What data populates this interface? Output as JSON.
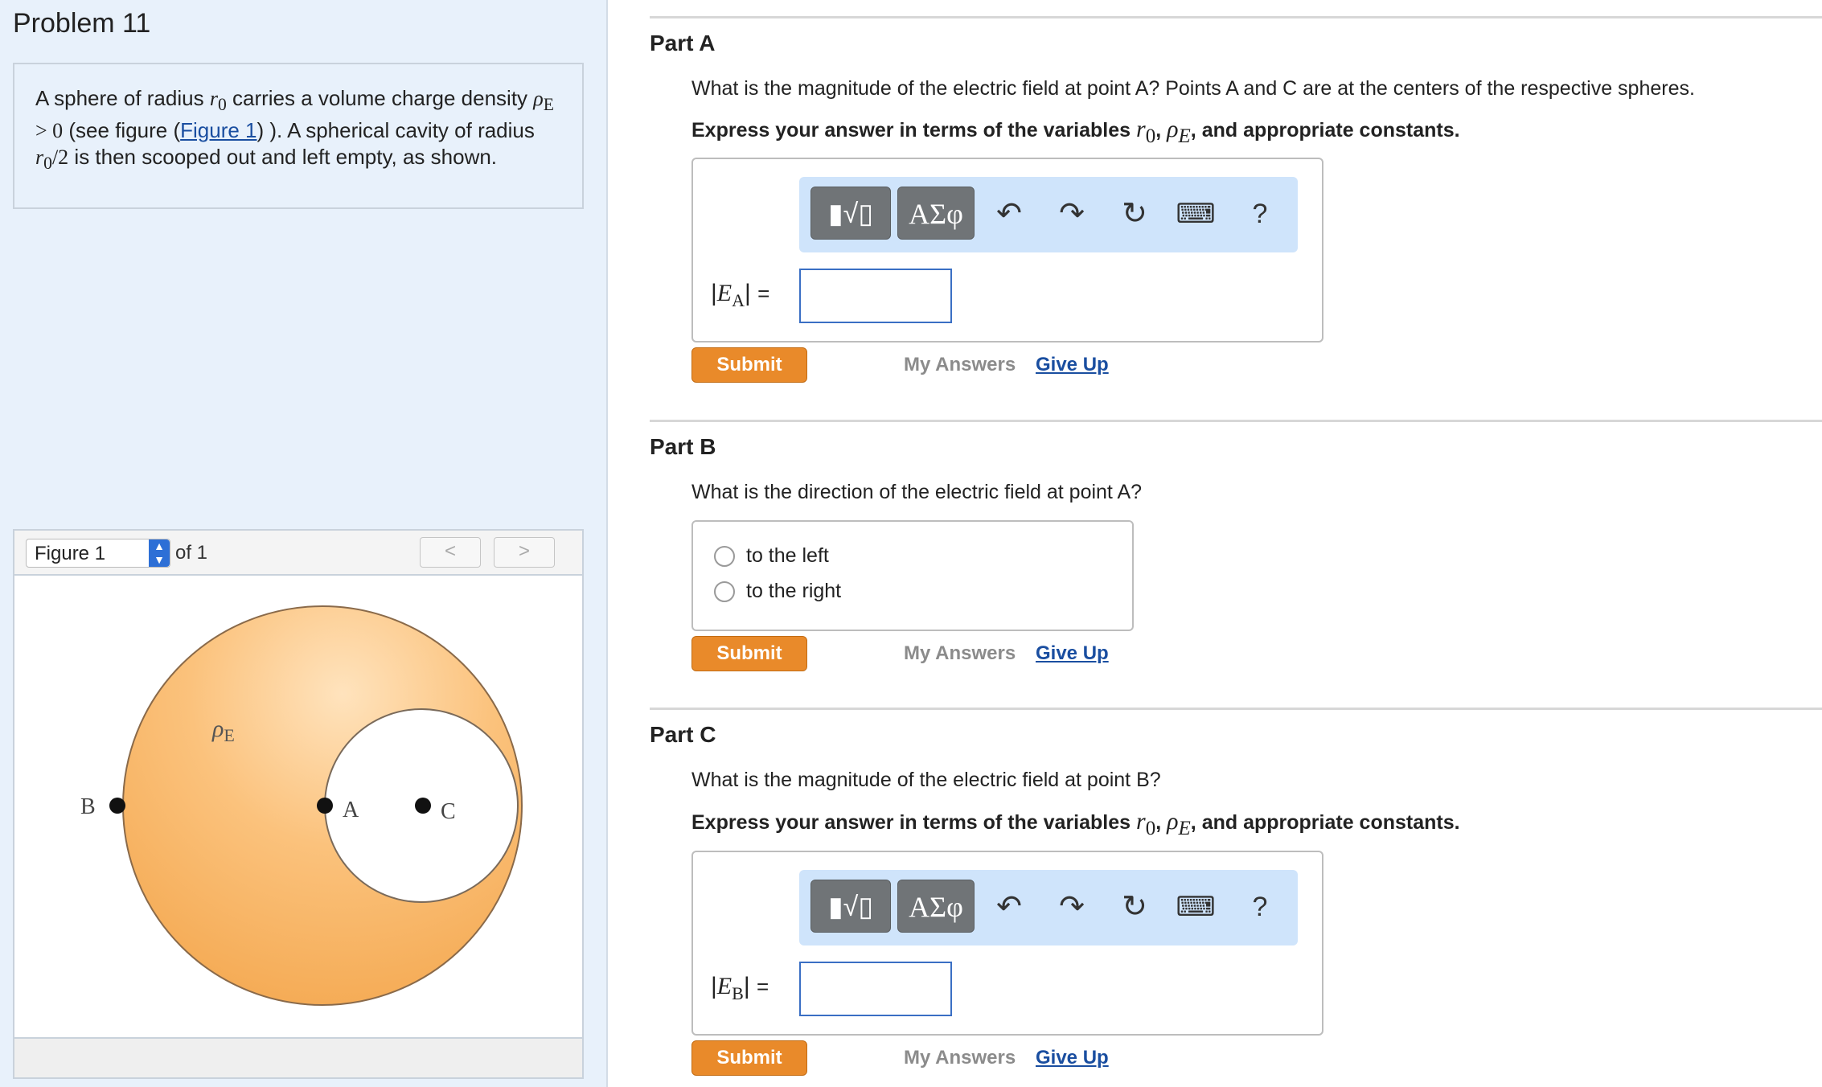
{
  "problem": {
    "title": "Problem 11",
    "text_1": "A sphere of radius ",
    "var_r": "r",
    "sub_0": "0",
    "text_2": " carries a volume charge density ",
    "var_rho": "ρ",
    "sub_E": "E",
    "text_gt": " > 0",
    "text_3": " (see figure (",
    "figure_link": "Figure 1",
    "text_4": ") ). A spherical cavity of radius ",
    "text_half": "/2",
    "text_5": " is then scooped out and left empty, as shown."
  },
  "figure": {
    "selector_value": "Figure 1",
    "of_text": "of 1",
    "prev_label": "<",
    "next_label": ">",
    "label_rho": "ρ",
    "label_rho_sub": "E",
    "label_B": "B",
    "label_A": "A",
    "label_C": "C",
    "sphere_color": "#f6b461",
    "cavity_color": "#ffffff"
  },
  "part_a": {
    "title": "Part A",
    "question": "What is the magnitude of the electric field at point A? Points A and C are at the centers of the respective spheres.",
    "instruction_pre": "Express your answer in terms of the variables ",
    "instruction_post": ", and appropriate constants.",
    "answer_var": "E",
    "answer_sub": "A",
    "equals": "="
  },
  "part_b": {
    "title": "Part B",
    "question": "What is the direction of the electric field at point A?",
    "options": [
      "to the left",
      "to the right"
    ]
  },
  "part_c": {
    "title": "Part C",
    "question": "What is the magnitude of the electric field at point B?",
    "instruction_pre": "Express your answer in terms of the variables ",
    "instruction_post": ", and appropriate constants.",
    "answer_var": "E",
    "answer_sub": "B",
    "equals": "="
  },
  "toolbar": {
    "greek_label": "ΑΣφ",
    "help_label": "?",
    "icons": [
      "templates-icon",
      "greek-letters-icon",
      "undo-icon",
      "redo-icon",
      "reset-icon",
      "keyboard-icon",
      "help-icon"
    ]
  },
  "actions": {
    "submit": "Submit",
    "my_answers": "My Answers",
    "give_up": "Give Up"
  },
  "colors": {
    "accent_orange": "#e98a2a",
    "link_blue": "#1a4ea0",
    "toolbar_blue": "#cfe4fb",
    "left_panel_bg": "#e8f1fb"
  }
}
